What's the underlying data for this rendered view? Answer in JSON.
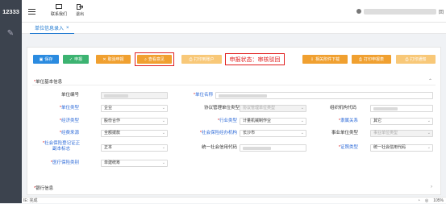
{
  "brand": "12333",
  "topbar": {
    "btn1": "联系我们",
    "btn2": "退出",
    "user_suffix": "回"
  },
  "tab": {
    "label": "单位信息录入",
    "close": "×"
  },
  "toolbar": {
    "save": "保存",
    "submit": "申报",
    "cancel": "取消申报",
    "check": "查看意见",
    "print_status": "打印到账户",
    "attach": "相关附件下载",
    "print_sheet": "打印申报表",
    "print_notice": "打印通知"
  },
  "status_text": "申报状态：审核驳回",
  "section1": {
    "title": "单位基本信息",
    "arrow": "⌃"
  },
  "fields": {
    "unit_no": "单位编号",
    "unit_name": "单位名称",
    "unit_type": "单位类型",
    "unit_type_val": "企业",
    "mgmt_type": "协议管理单位类型",
    "mgmt_type_val": "协议管理单位类型",
    "org_code": "组织机构代码",
    "econ_type": "经济类型",
    "econ_type_val": "股份合作",
    "industry": "行业类型",
    "industry_val": "计量机械制作业",
    "affiliation": "隶属关系",
    "affiliation_val": "其它",
    "fund_source": "经费来源",
    "fund_source_val": "全额拨款",
    "si_agency": "社会保险经办机构",
    "si_agency_val": "长沙市",
    "inst_type": "事业单位类型",
    "inst_type_val": "事业单位类型",
    "reg_flag": "社会保险登记证正副本标志",
    "reg_flag_val": "正本",
    "credit_code": "统一社会信用代码",
    "cert_type": "证照类型",
    "cert_type_val": "统一社会信用代码",
    "med_cat": "医疗保险类别",
    "med_cat_val": "单建统筹"
  },
  "section2": {
    "title": "银行信息",
    "arrow": "›"
  },
  "statusbar": {
    "left": "IE: 完成",
    "zoom": "105%"
  },
  "colors": {
    "blue": "#2b8be0",
    "green": "#3cb371",
    "orange": "#f0a030",
    "lightorange": "#f8c878",
    "red": "#e02020"
  }
}
